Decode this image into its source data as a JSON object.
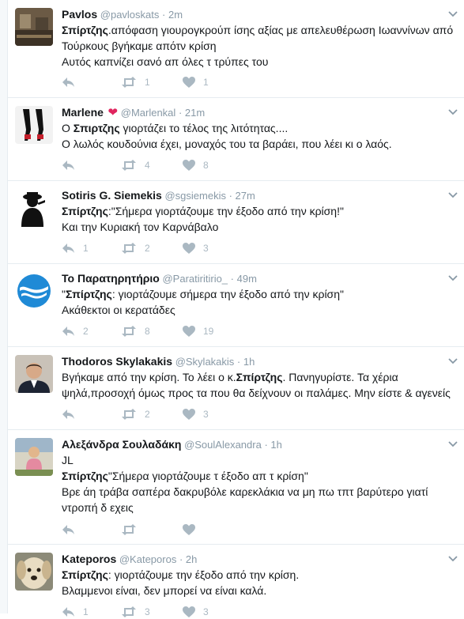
{
  "tweets": [
    {
      "name": "Pavlos",
      "handle": "@pavloskats",
      "time": "2m",
      "heart_badge": false,
      "lines": [
        [
          {
            "t": "Σπίρτζης",
            "b": true
          },
          {
            "t": ".απόφαση γιουρογκρούπ ίσης αξίας με απελευθέρωση Ιωαννίνων από",
            "b": false
          }
        ],
        [
          {
            "t": "Τούρκους βγήκαμε απότν κρίση",
            "b": false
          }
        ],
        [
          {
            "t": "Αυτός καπνίζει σανό απ όλες τ τρύπες του",
            "b": false
          }
        ]
      ],
      "reply": "",
      "retweets": "1",
      "likes": "1"
    },
    {
      "name": "Marlene",
      "handle": "@Marlenkal",
      "time": "21m",
      "heart_badge": true,
      "lines": [
        [
          {
            "t": "Ο ",
            "b": false
          },
          {
            "t": "Σπιρτζης",
            "b": true
          },
          {
            "t": " γιορτάζει το τέλος της λιτότητας....",
            "b": false
          }
        ],
        [
          {
            "t": "Ο λωλός κουδούνια έχει, μοναχός του τα βαράει, που λέει κι ο λαός.",
            "b": false
          }
        ]
      ],
      "reply": "",
      "retweets": "4",
      "likes": "8"
    },
    {
      "name": "Sotiris G. Siemekis",
      "handle": "@sgsiemekis",
      "time": "27m",
      "heart_badge": false,
      "lines": [
        [
          {
            "t": "Σπίρτζης",
            "b": true
          },
          {
            "t": ":\"Σήμερα γιορτάζουμε την έξοδο από την κρίση!\"",
            "b": false
          }
        ],
        [
          {
            "t": "Και την Κυριακή τον Καρνάβαλο",
            "b": false
          }
        ]
      ],
      "reply": "1",
      "retweets": "2",
      "likes": "3"
    },
    {
      "name": "Το Παρατηρητήριο",
      "handle": "@Paratiritirio_",
      "time": "49m",
      "heart_badge": false,
      "lines": [
        [
          {
            "t": "\"",
            "b": false
          },
          {
            "t": "Σπίρτζης",
            "b": true
          },
          {
            "t": ": γιορτάζουμε σήμερα την έξοδο από την κρίση\"",
            "b": false
          }
        ],
        [
          {
            "t": "Ακάθεκτοι οι κερατάδες",
            "b": false
          }
        ]
      ],
      "reply": "2",
      "retweets": "8",
      "likes": "19"
    },
    {
      "name": "Thodoros Skylakakis",
      "handle": "@Skylakakis",
      "time": "1h",
      "heart_badge": false,
      "lines": [
        [
          {
            "t": "Βγήκαμε από την κρίση. Το λέει ο κ.",
            "b": false
          },
          {
            "t": "Σπίρτζης",
            "b": true
          },
          {
            "t": ". Πανηγυρίστε. Τα χέρια",
            "b": false
          }
        ],
        [
          {
            "t": "ψηλά,προσοχή όμως προς τα που θα δείχνουν οι παλάμες. Μην είστε & αγενείς",
            "b": false
          }
        ]
      ],
      "reply": "",
      "retweets": "2",
      "likes": "3"
    },
    {
      "name": "Αλεξάνδρα Σουλαδάκη",
      "handle": "@SoulAlexandra",
      "time": "1h",
      "heart_badge": false,
      "lines": [
        [
          {
            "t": "JL",
            "b": false
          }
        ],
        [
          {
            "t": "Σπίρτζης",
            "b": true
          },
          {
            "t": "\"Σήμερα γιορτάζουμε τ έξοδο απ τ κρίση\"",
            "b": false
          }
        ],
        [
          {
            "t": "Βρε άη τράβα σαπέρα δακρυβόλε καρεκλάκια να μη πω τπτ βαρύτερο γιατί",
            "b": false
          }
        ],
        [
          {
            "t": "ντροπή δ εχεις",
            "b": false
          }
        ]
      ],
      "reply": "",
      "retweets": "",
      "likes": ""
    },
    {
      "name": "Kateporos",
      "handle": "@Kateporos",
      "time": "2h",
      "heart_badge": false,
      "lines": [
        [
          {
            "t": "Σπίρτζης",
            "b": true
          },
          {
            "t": ": γιορτάζουμε την έξοδο από την κρίση.",
            "b": false
          }
        ],
        [
          {
            "t": "Βλαμμενοι είναι, δεν μπορεί να είναι καλά.",
            "b": false
          }
        ]
      ],
      "reply": "1",
      "retweets": "3",
      "likes": "3"
    }
  ],
  "icons": {
    "reply": "reply-icon",
    "retweet": "retweet-icon",
    "like": "heart-icon",
    "caret": "chevron-down-icon"
  },
  "colors": {
    "action_gray": "#aab8c2",
    "handle_gray": "#8899a6",
    "border": "#e6ecf0",
    "badge_red": "#e0245e"
  }
}
